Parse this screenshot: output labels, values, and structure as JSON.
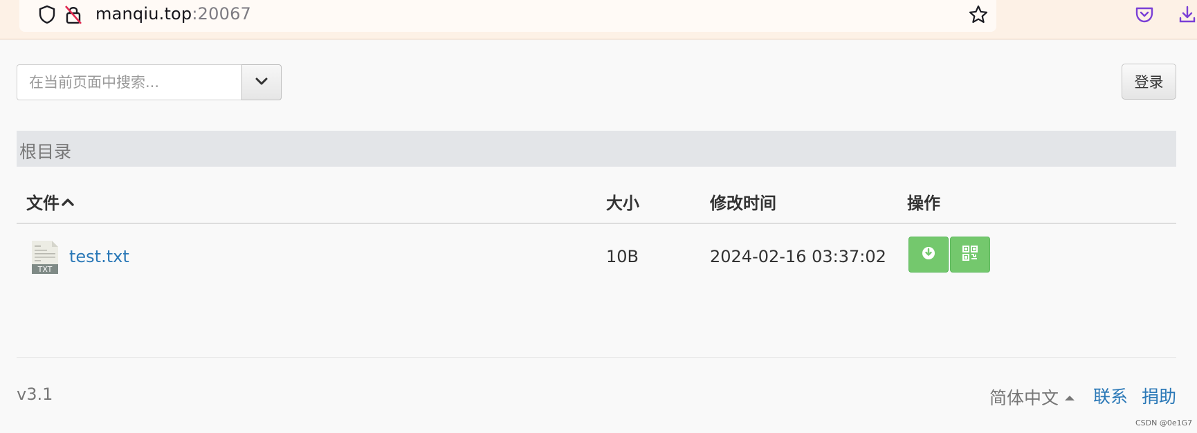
{
  "browser": {
    "url_host": "manqiu.top",
    "url_port": ":20067"
  },
  "search": {
    "placeholder": "在当前页面中搜索..."
  },
  "login_label": "登录",
  "breadcrumb": "根目录",
  "table": {
    "headers": {
      "file": "文件",
      "size": "大小",
      "modified": "修改时间",
      "actions": "操作"
    },
    "rows": [
      {
        "name": "test.txt",
        "size": "10B",
        "modified": "2024-02-16 03:37:02",
        "type_badge": "TXT"
      }
    ]
  },
  "footer": {
    "version": "v3.1",
    "language": "简体中文",
    "contact": "联系",
    "donate": "捐助"
  },
  "watermark": "CSDN @0e1G7",
  "colors": {
    "accent_link": "#2a78b7",
    "action_button": "#74c86d",
    "browser_bar": "#fdf1e6"
  },
  "icons": [
    "shield-icon",
    "insecure-lock-icon",
    "star-icon",
    "pocket-icon",
    "download-tray-icon",
    "chevron-down-icon",
    "sort-up-icon",
    "txt-file-icon",
    "download-icon",
    "qrcode-icon",
    "caret-up-icon"
  ]
}
